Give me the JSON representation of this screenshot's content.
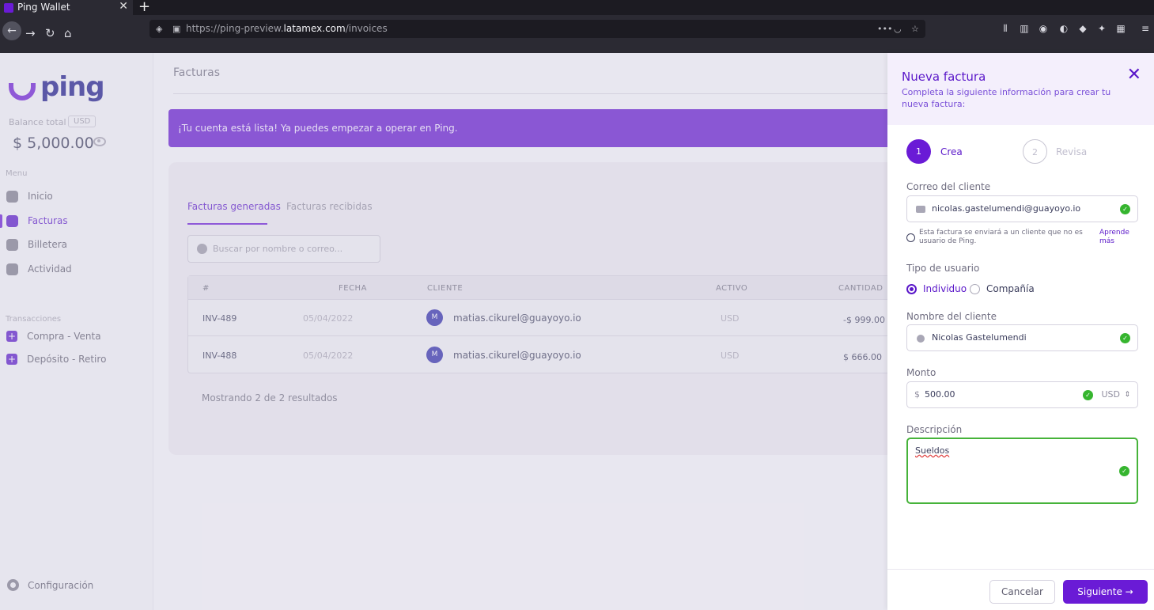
{
  "browser": {
    "tab_title": "Ping Wallet",
    "tab_close": "✕",
    "new_tab": "+",
    "url_prefix": "https://ping-preview.",
    "url_host": "latamex.com",
    "url_path": "/invoices"
  },
  "sidebar": {
    "logo": "ping",
    "balance_label": "Balance total",
    "currency": "USD",
    "balance": "$ 5,000.00",
    "menu_label": "Menu",
    "items": [
      {
        "label": "Inicio",
        "icon": "home-icon"
      },
      {
        "label": "Facturas",
        "icon": "invoice-icon",
        "active": true
      },
      {
        "label": "Billetera",
        "icon": "wallet-icon"
      },
      {
        "label": "Actividad",
        "icon": "activity-icon"
      }
    ],
    "transactions_label": "Transacciones",
    "transactions": [
      {
        "label": "Compra - Venta",
        "icon": "plus-icon"
      },
      {
        "label": "Depósito - Retiro",
        "icon": "plus-icon"
      }
    ],
    "settings": "Configuración"
  },
  "main": {
    "title": "Facturas",
    "banner": "¡Tu cuenta está lista! Ya puedes empezar a operar en Ping.",
    "tabs": [
      "Facturas generadas",
      "Facturas recibidas"
    ],
    "search_placeholder": "Buscar por nombre o correo...",
    "columns": [
      "#",
      "FECHA",
      "CLIENTE",
      "ACTIVO",
      "CANTIDAD"
    ],
    "rows": [
      {
        "id": "INV-489",
        "date": "05/04/2022",
        "avatar": "M",
        "client": "matias.cikurel@guayoyo.io",
        "asset": "USD",
        "amount": "-$ 999.00"
      },
      {
        "id": "INV-488",
        "date": "05/04/2022",
        "avatar": "M",
        "client": "matias.cikurel@guayoyo.io",
        "asset": "USD",
        "amount": "$ 666.00"
      }
    ],
    "results": "Mostrando 2 de 2 resultados"
  },
  "panel": {
    "title": "Nueva factura",
    "subtitle": "Completa la siguiente información para crear tu nueva factura:",
    "steps": [
      {
        "number": "1",
        "label": "Crea"
      },
      {
        "number": "2",
        "label": "Revisa"
      }
    ],
    "email_label": "Correo del cliente",
    "email_value": "nicolas.gastelumendi@guayoyo.io",
    "notice": "Esta factura se enviará a un cliente que no es usuario de Ping.",
    "notice_link": "Aprende más",
    "user_type_label": "Tipo de usuario",
    "user_types": [
      "Individuo",
      "Compañía"
    ],
    "name_label": "Nombre del cliente",
    "name_value": "Nicolas Gastelumendi",
    "amount_label": "Monto",
    "amount_prefix": "$",
    "amount_value": "500.00",
    "amount_currency": "USD",
    "description_label": "Descripción",
    "description_value": "Sueldos",
    "cancel": "Cancelar",
    "next": "Siguiente →"
  },
  "colors": {
    "brand": "#6a1bd6",
    "success": "#36b52f"
  }
}
